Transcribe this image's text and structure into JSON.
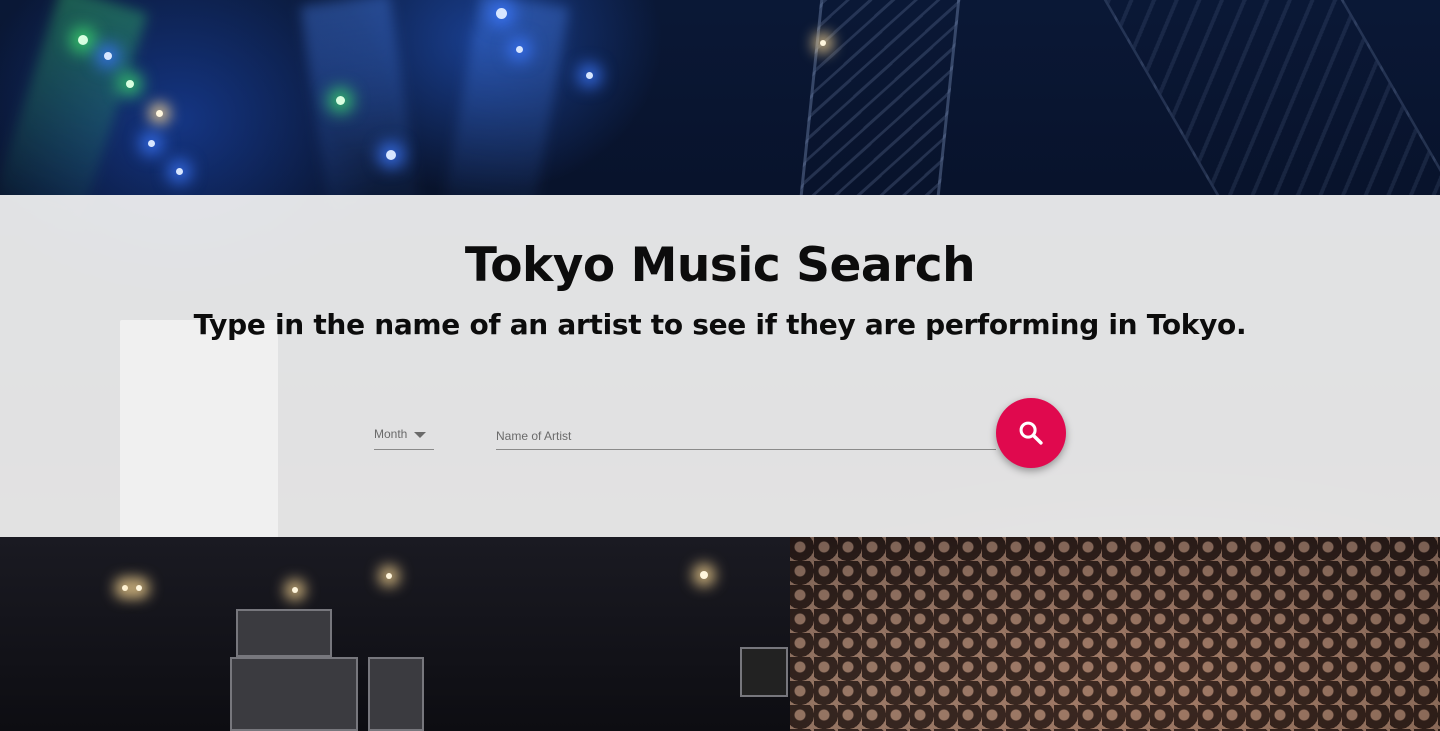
{
  "hero": {
    "title": "Tokyo Music Search",
    "subtitle": "Type in the name of an artist to see if they are performing in Tokyo."
  },
  "search": {
    "month_label": "Month",
    "artist_placeholder": "Name of Artist",
    "artist_value": "",
    "submit_icon": "search-icon"
  },
  "colors": {
    "accent": "#e0094e",
    "panel_background": "#f2f2f2",
    "text": "#0c0c0c"
  }
}
